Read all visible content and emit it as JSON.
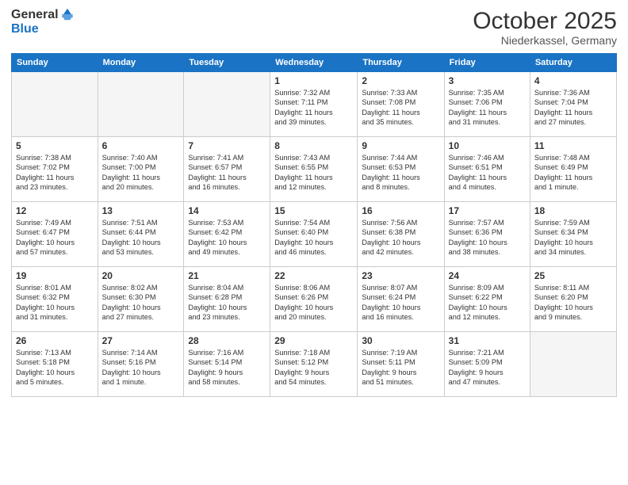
{
  "header": {
    "logo_general": "General",
    "logo_blue": "Blue",
    "title": "October 2025",
    "location": "Niederkassel, Germany"
  },
  "weekdays": [
    "Sunday",
    "Monday",
    "Tuesday",
    "Wednesday",
    "Thursday",
    "Friday",
    "Saturday"
  ],
  "weeks": [
    [
      {
        "day": "",
        "info": ""
      },
      {
        "day": "",
        "info": ""
      },
      {
        "day": "",
        "info": ""
      },
      {
        "day": "1",
        "info": "Sunrise: 7:32 AM\nSunset: 7:11 PM\nDaylight: 11 hours\nand 39 minutes."
      },
      {
        "day": "2",
        "info": "Sunrise: 7:33 AM\nSunset: 7:08 PM\nDaylight: 11 hours\nand 35 minutes."
      },
      {
        "day": "3",
        "info": "Sunrise: 7:35 AM\nSunset: 7:06 PM\nDaylight: 11 hours\nand 31 minutes."
      },
      {
        "day": "4",
        "info": "Sunrise: 7:36 AM\nSunset: 7:04 PM\nDaylight: 11 hours\nand 27 minutes."
      }
    ],
    [
      {
        "day": "5",
        "info": "Sunrise: 7:38 AM\nSunset: 7:02 PM\nDaylight: 11 hours\nand 23 minutes."
      },
      {
        "day": "6",
        "info": "Sunrise: 7:40 AM\nSunset: 7:00 PM\nDaylight: 11 hours\nand 20 minutes."
      },
      {
        "day": "7",
        "info": "Sunrise: 7:41 AM\nSunset: 6:57 PM\nDaylight: 11 hours\nand 16 minutes."
      },
      {
        "day": "8",
        "info": "Sunrise: 7:43 AM\nSunset: 6:55 PM\nDaylight: 11 hours\nand 12 minutes."
      },
      {
        "day": "9",
        "info": "Sunrise: 7:44 AM\nSunset: 6:53 PM\nDaylight: 11 hours\nand 8 minutes."
      },
      {
        "day": "10",
        "info": "Sunrise: 7:46 AM\nSunset: 6:51 PM\nDaylight: 11 hours\nand 4 minutes."
      },
      {
        "day": "11",
        "info": "Sunrise: 7:48 AM\nSunset: 6:49 PM\nDaylight: 11 hours\nand 1 minute."
      }
    ],
    [
      {
        "day": "12",
        "info": "Sunrise: 7:49 AM\nSunset: 6:47 PM\nDaylight: 10 hours\nand 57 minutes."
      },
      {
        "day": "13",
        "info": "Sunrise: 7:51 AM\nSunset: 6:44 PM\nDaylight: 10 hours\nand 53 minutes."
      },
      {
        "day": "14",
        "info": "Sunrise: 7:53 AM\nSunset: 6:42 PM\nDaylight: 10 hours\nand 49 minutes."
      },
      {
        "day": "15",
        "info": "Sunrise: 7:54 AM\nSunset: 6:40 PM\nDaylight: 10 hours\nand 46 minutes."
      },
      {
        "day": "16",
        "info": "Sunrise: 7:56 AM\nSunset: 6:38 PM\nDaylight: 10 hours\nand 42 minutes."
      },
      {
        "day": "17",
        "info": "Sunrise: 7:57 AM\nSunset: 6:36 PM\nDaylight: 10 hours\nand 38 minutes."
      },
      {
        "day": "18",
        "info": "Sunrise: 7:59 AM\nSunset: 6:34 PM\nDaylight: 10 hours\nand 34 minutes."
      }
    ],
    [
      {
        "day": "19",
        "info": "Sunrise: 8:01 AM\nSunset: 6:32 PM\nDaylight: 10 hours\nand 31 minutes."
      },
      {
        "day": "20",
        "info": "Sunrise: 8:02 AM\nSunset: 6:30 PM\nDaylight: 10 hours\nand 27 minutes."
      },
      {
        "day": "21",
        "info": "Sunrise: 8:04 AM\nSunset: 6:28 PM\nDaylight: 10 hours\nand 23 minutes."
      },
      {
        "day": "22",
        "info": "Sunrise: 8:06 AM\nSunset: 6:26 PM\nDaylight: 10 hours\nand 20 minutes."
      },
      {
        "day": "23",
        "info": "Sunrise: 8:07 AM\nSunset: 6:24 PM\nDaylight: 10 hours\nand 16 minutes."
      },
      {
        "day": "24",
        "info": "Sunrise: 8:09 AM\nSunset: 6:22 PM\nDaylight: 10 hours\nand 12 minutes."
      },
      {
        "day": "25",
        "info": "Sunrise: 8:11 AM\nSunset: 6:20 PM\nDaylight: 10 hours\nand 9 minutes."
      }
    ],
    [
      {
        "day": "26",
        "info": "Sunrise: 7:13 AM\nSunset: 5:18 PM\nDaylight: 10 hours\nand 5 minutes."
      },
      {
        "day": "27",
        "info": "Sunrise: 7:14 AM\nSunset: 5:16 PM\nDaylight: 10 hours\nand 1 minute."
      },
      {
        "day": "28",
        "info": "Sunrise: 7:16 AM\nSunset: 5:14 PM\nDaylight: 9 hours\nand 58 minutes."
      },
      {
        "day": "29",
        "info": "Sunrise: 7:18 AM\nSunset: 5:12 PM\nDaylight: 9 hours\nand 54 minutes."
      },
      {
        "day": "30",
        "info": "Sunrise: 7:19 AM\nSunset: 5:11 PM\nDaylight: 9 hours\nand 51 minutes."
      },
      {
        "day": "31",
        "info": "Sunrise: 7:21 AM\nSunset: 5:09 PM\nDaylight: 9 hours\nand 47 minutes."
      },
      {
        "day": "",
        "info": ""
      }
    ]
  ]
}
